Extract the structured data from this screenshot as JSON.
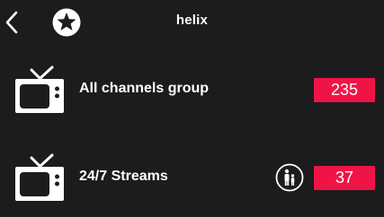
{
  "header": {
    "title": "helix",
    "back_icon": "back-chevron-icon",
    "favorite_icon": "star-icon"
  },
  "rows": [
    {
      "icon": "tv-icon",
      "label": "All channels group",
      "count": "235"
    },
    {
      "icon": "tv-icon",
      "label": "24/7 Streams",
      "count": "37",
      "extra_icon": "family-icon"
    }
  ],
  "colors": {
    "background": "#1c1c1e",
    "badge": "#f01446",
    "text": "#ffffff"
  }
}
